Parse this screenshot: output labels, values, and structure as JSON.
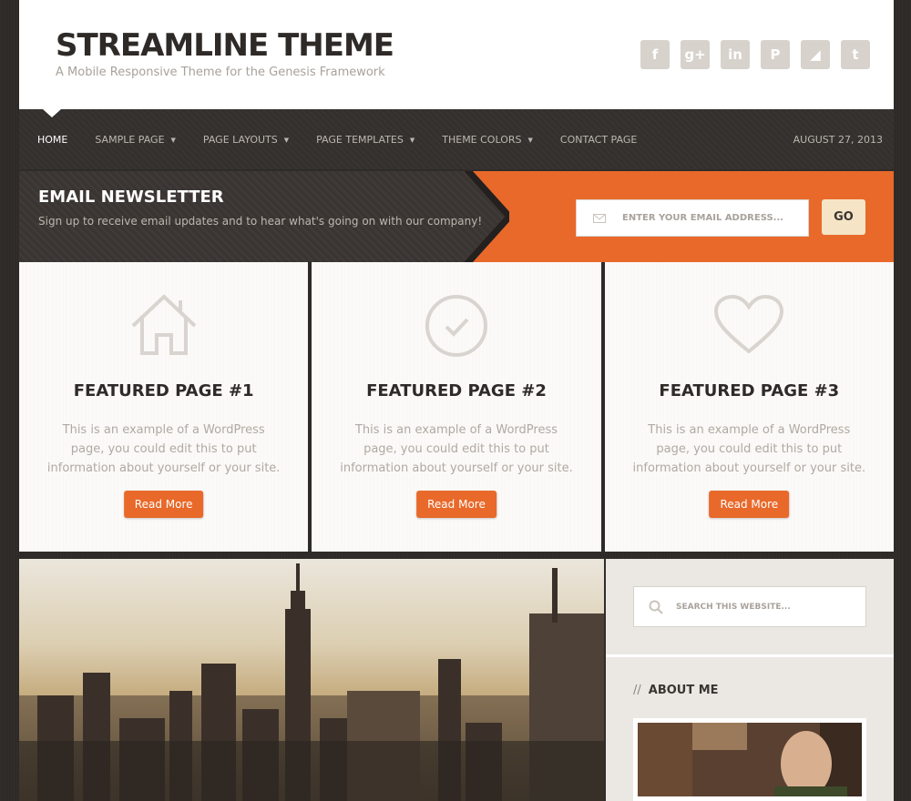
{
  "header": {
    "title": "STREAMLINE THEME",
    "description": "A Mobile Responsive Theme for the Genesis Framework",
    "social": [
      {
        "icon": "facebook-icon",
        "glyph": "f"
      },
      {
        "icon": "google-plus-icon",
        "glyph": "g+"
      },
      {
        "icon": "linkedin-icon",
        "glyph": "in"
      },
      {
        "icon": "pinterest-icon",
        "glyph": "P"
      },
      {
        "icon": "rss-icon",
        "glyph": "◢"
      },
      {
        "icon": "twitter-icon",
        "glyph": "t"
      }
    ]
  },
  "nav": {
    "items": [
      {
        "label": "HOME",
        "active": true,
        "dropdown": false
      },
      {
        "label": "SAMPLE PAGE",
        "active": false,
        "dropdown": true
      },
      {
        "label": "PAGE LAYOUTS",
        "active": false,
        "dropdown": true
      },
      {
        "label": "PAGE TEMPLATES",
        "active": false,
        "dropdown": true
      },
      {
        "label": "THEME COLORS",
        "active": false,
        "dropdown": true
      },
      {
        "label": "CONTACT PAGE",
        "active": false,
        "dropdown": false
      }
    ],
    "date": "AUGUST 27, 2013"
  },
  "newsletter": {
    "title": "EMAIL NEWSLETTER",
    "description": "Sign up to receive email updates and to hear what's going on with our company!",
    "placeholder": "ENTER YOUR EMAIL ADDRESS...",
    "button": "GO"
  },
  "features": [
    {
      "icon": "home-icon",
      "title": "FEATURED PAGE #1",
      "text": "This is an example of a WordPress page, you could edit this to put information about yourself or your site.",
      "button": "Read More"
    },
    {
      "icon": "checkmark-circle-icon",
      "title": "FEATURED PAGE #2",
      "text": "This is an example of a WordPress page, you could edit this to put information about yourself or your site.",
      "button": "Read More"
    },
    {
      "icon": "heart-icon",
      "title": "FEATURED PAGE #3",
      "text": "This is an example of a WordPress page, you could edit this to put information about yourself or your site.",
      "button": "Read More"
    }
  ],
  "sidebar": {
    "search_placeholder": "SEARCH THIS WEBSITE...",
    "about_title": "ABOUT ME"
  },
  "colors": {
    "accent": "#e8692a",
    "dark": "#2e2a28",
    "button_go": "#f5e4c6"
  }
}
